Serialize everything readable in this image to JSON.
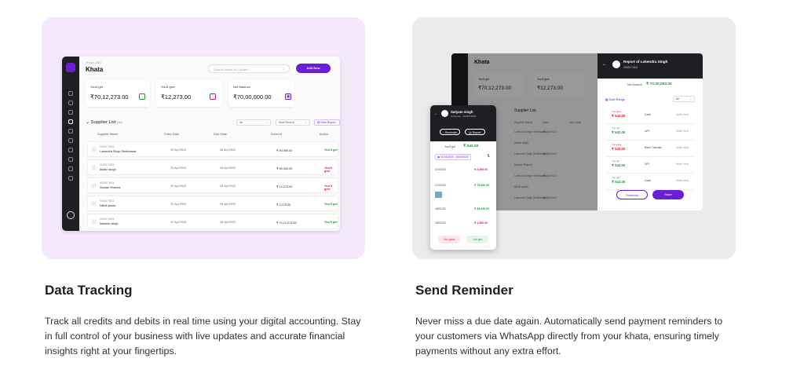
{
  "features": [
    {
      "title": "Data Tracking",
      "description": "Track all credits and debits in real time using your digital accounting. Stay in full control of your business with live updates and accurate financial insights right at your fingertips."
    },
    {
      "title": "Send Reminder",
      "description": "Never miss a due date again. Automatically send payment reminders to your customers via WhatsApp directly from your khata, ensuring timely payments without any extra effort."
    }
  ],
  "mock1": {
    "date": "29 Apr, 2023",
    "title": "Khata",
    "search_placeholder": "Search Name or Contact",
    "add_label": "Add New",
    "stats": [
      {
        "label": "You'll get",
        "value": "₹70,12,273.00",
        "icon": "arrow-down-icon",
        "color": "#1a9a3c"
      },
      {
        "label": "You'll give",
        "value": "₹12,273.00",
        "icon": "arrow-up-icon",
        "color": "#d81b3c"
      },
      {
        "label": "Net Balance",
        "value": "₹70,00,000.00",
        "icon": "wallet-icon",
        "color": "#6a1fd6"
      }
    ],
    "list_title": "Supplier List",
    "list_count": "(15)",
    "filter": "All",
    "sort": "Most Recent",
    "report_label": "View Report",
    "columns": [
      "Supplier Name",
      "Entry Date",
      "Due Date",
      "Amount",
      "Action"
    ],
    "rows": [
      {
        "phone": "9638573804",
        "name": "Lokendra Singh Shekhawat",
        "entry": "20 Apr'2023",
        "due": "28 Apr'2023",
        "amount": "₹ 40,000.00",
        "action": "You'll get",
        "type": "get"
      },
      {
        "phone": "9638573804",
        "name": "Akash singh",
        "entry": "20 Apr'2023",
        "due": "28 Apr'2023",
        "amount": "₹ 90,000.00",
        "action": "You'll give",
        "type": "give"
      },
      {
        "phone": "9638573804",
        "name": "Saurav Sharma",
        "entry": "20 Apr'2023",
        "due": "28 Apr'2023",
        "amount": "₹ 12,273.00",
        "action": "You'll give",
        "type": "give"
      },
      {
        "phone": "9638573804",
        "name": "Nikhil yadav",
        "entry": "20 Apr'2023",
        "due": "28 Apr'2023",
        "amount": "₹ 2,273.00",
        "action": "You'll get",
        "type": "get"
      },
      {
        "phone": "9638573804",
        "name": "Mahesh singh",
        "entry": "20 Apr'2023",
        "due": "28 Apr'2023",
        "amount": "₹ 70,12,273.00",
        "action": "You'll get",
        "type": "get"
      }
    ]
  },
  "mock2": {
    "title": "Khata",
    "stat1_label": "You'll get",
    "stat1_value": "₹70,12,273.00",
    "stat2_label": "You'll give",
    "stat2_value": "₹12,273.00",
    "list_title": "Supplier List",
    "columns": [
      "Supplier Name",
      "Date",
      "Due Date"
    ],
    "bg_rows": [
      "Lokendra Singh Shekhawat",
      "Akash singh",
      "Lokendra Singh Shekhawat",
      "Saurav Sharma",
      "Lokendra Singh Shekhawat",
      "Nikhil yadav",
      "Lokendra Singh Shekhawat"
    ],
    "bg_date": "20 Apr'2023",
    "report_title": "Report of Lokendra Singh",
    "report_phone": "9638573804",
    "net_label": "Net Balance",
    "net_value": "₹ 70,00,000.00",
    "range_label": "Date Range",
    "range_value": "All",
    "entries": [
      {
        "label": "You gave",
        "value": "₹ 542.00",
        "type": "gave",
        "mode": "Cash",
        "note": "Note Here"
      },
      {
        "label": "You got",
        "value": "₹ 542.00",
        "type": "got",
        "mode": "UPI",
        "note": "Note Here"
      },
      {
        "label": "You gave",
        "value": "₹ 542.00",
        "type": "gave",
        "mode": "Bank Transfer",
        "note": "Note Here"
      },
      {
        "label": "You got",
        "value": "₹ 542.00",
        "type": "got",
        "mode": "UPI",
        "note": "Note Here"
      },
      {
        "label": "You got",
        "value": "₹ 542.00",
        "type": "got",
        "mode": "Cash",
        "note": "Note Here"
      }
    ],
    "download_label": "Download",
    "share_label": "Share",
    "phone": {
      "name": "Satyam singh",
      "sub": "Customer · 9638573804",
      "reminder_label": "Reminder",
      "report_label": "Report",
      "balance_label": "You'll get",
      "balance_value": "₹ 542.00",
      "date_range": "01/04/2023 - 30/04/2023",
      "tx": [
        {
          "date": "21/02/23",
          "amount": "₹ 3,500.00",
          "type": "red"
        },
        {
          "date": "21/02/23",
          "amount": "₹ 75,000.00",
          "type": "green"
        },
        {
          "date": "18/02/23",
          "amount": "₹ 35,000.00",
          "type": "green"
        },
        {
          "date": "18/02/23",
          "amount": "₹ 1,500.00",
          "type": "red"
        }
      ],
      "gave_label": "You gave",
      "got_label": "You got"
    }
  }
}
